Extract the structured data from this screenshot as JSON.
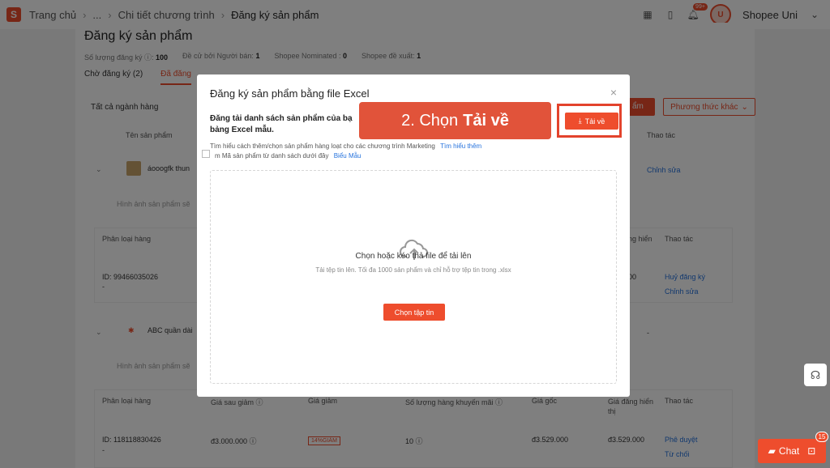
{
  "header": {
    "logo_text": "S",
    "breadcrumbs": [
      "Trang chủ",
      "...",
      "Chi tiết chương trình",
      "Đăng ký sản phẩm"
    ],
    "notif_count": "99+",
    "user_name": "Shopee Uni",
    "avatar_text": "U"
  },
  "page": {
    "title": "Đăng ký sản phẩm",
    "stats": [
      {
        "label": "Số lượng đăng ký ⓘ:",
        "value": "100"
      },
      {
        "label": "Đề cử bởi Người bán:",
        "value": "1"
      },
      {
        "label": "Shopee Nominated :",
        "value": "0"
      },
      {
        "label": "Shopee đề xuất:",
        "value": "1"
      }
    ],
    "tabs": [
      "Chờ đăng ký (2)",
      "Đã đăng"
    ],
    "filter_label": "Tất cả ngành hàng",
    "btn_partial": "ẩm",
    "method_button": "Phương thức khác",
    "col_product": "Tên sản phẩm",
    "col_action": "Thao tác",
    "product1_name": "áooogfk thun",
    "product1_edit": "Chỉnh sửa",
    "hint_text": "Hình ảnh sản phẩm sẽ",
    "variant_header": "Phân loại hàng",
    "price_col_partial": "ng hiển",
    "action_header": "Thao tác",
    "id1": "ID: 99466035026",
    "id1_sub": "-",
    "price1_partial": "00",
    "link_cancel": "Huỷ đăng ký",
    "link_edit": "Chỉnh sửa",
    "product2_name": "ABC quần dài",
    "dash": "-",
    "hint_text2": "Hình ảnh sản phẩm sẽ",
    "row2_headers": {
      "variant": "Phân loại hàng",
      "discounted": "Giá sau giảm ⓘ",
      "discount": "Giá giảm",
      "qty": "Số lượng hàng khuyến mãi ⓘ",
      "original": "Giá gốc",
      "display_price": "Giá đăng hiển thị",
      "action": "Thao tác"
    },
    "row2": {
      "id": "ID: 118118830426",
      "id_sub": "-",
      "discounted": "đ3.000.000 ⓘ",
      "discount_tag": "14%GIẢM",
      "qty": "10 ⓘ",
      "original": "đ3.529.000",
      "display_price": "đ3.529.000",
      "approve": "Phê duyệt",
      "reject": "Từ chối"
    }
  },
  "modal": {
    "title": "Đăng ký sản phẩm bằng file Excel",
    "close": "×",
    "desc": "Đăng tải danh sách sản phẩm của bạ bảng Excel mẫu.",
    "learn_text": "Tìm hiểu cách thêm/chọn sản phẩm hàng loạt cho các chương trình Marketing",
    "learn_link": "Tìm hiểu thêm",
    "code_text": "m Mã sản phẩm từ danh sách dưới đây",
    "code_link": "Biểu Mẫu",
    "download_label": "Tải về",
    "dropzone_title": "Chọn hoặc kéo thả file để tải lên",
    "dropzone_sub": "Tải tệp tin lên. Tối đa 1000 sản phẩm và chỉ hỗ trợ tệp tin trong .xlsx",
    "choose_button": "Chọn tập tin"
  },
  "callout": {
    "prefix": "2. Chọn",
    "emphasis": "Tải về"
  },
  "widgets": {
    "chat_label": "Chat",
    "chat_badge": "15"
  },
  "colors": {
    "brand": "#ee4d2d",
    "link": "#2673dd",
    "callout": "#e1533a"
  }
}
